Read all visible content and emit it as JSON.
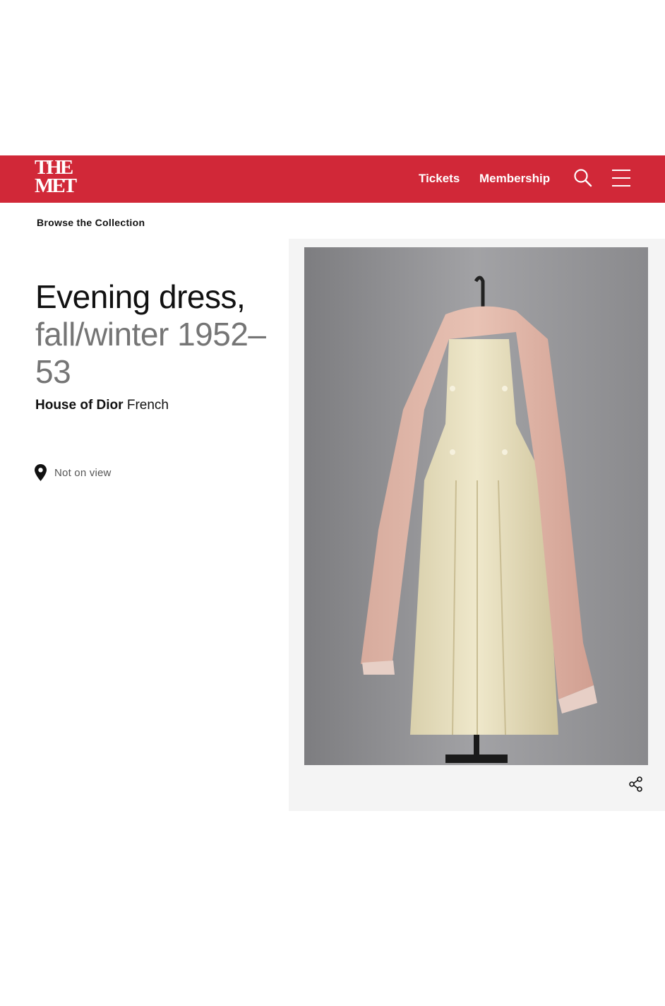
{
  "header": {
    "logo": {
      "line1": "THE",
      "line2": "MET"
    },
    "nav": {
      "tickets": "Tickets",
      "membership": "Membership"
    },
    "icons": {
      "search": "search-icon",
      "menu": "menu-icon"
    },
    "brand_color": "#d12838"
  },
  "breadcrumb": {
    "label": "Browse the Collection"
  },
  "object": {
    "title_main": "Evening dress,",
    "title_date": "fall/winter 1952–53",
    "maker_name": "House of Dior",
    "maker_nationality": "French",
    "location_status": "Not on view",
    "location_icon": "location-pin-icon"
  },
  "media": {
    "image_subject": "evening-dress-with-pink-stole-on-mannequin",
    "share_icon": "share-icon"
  }
}
